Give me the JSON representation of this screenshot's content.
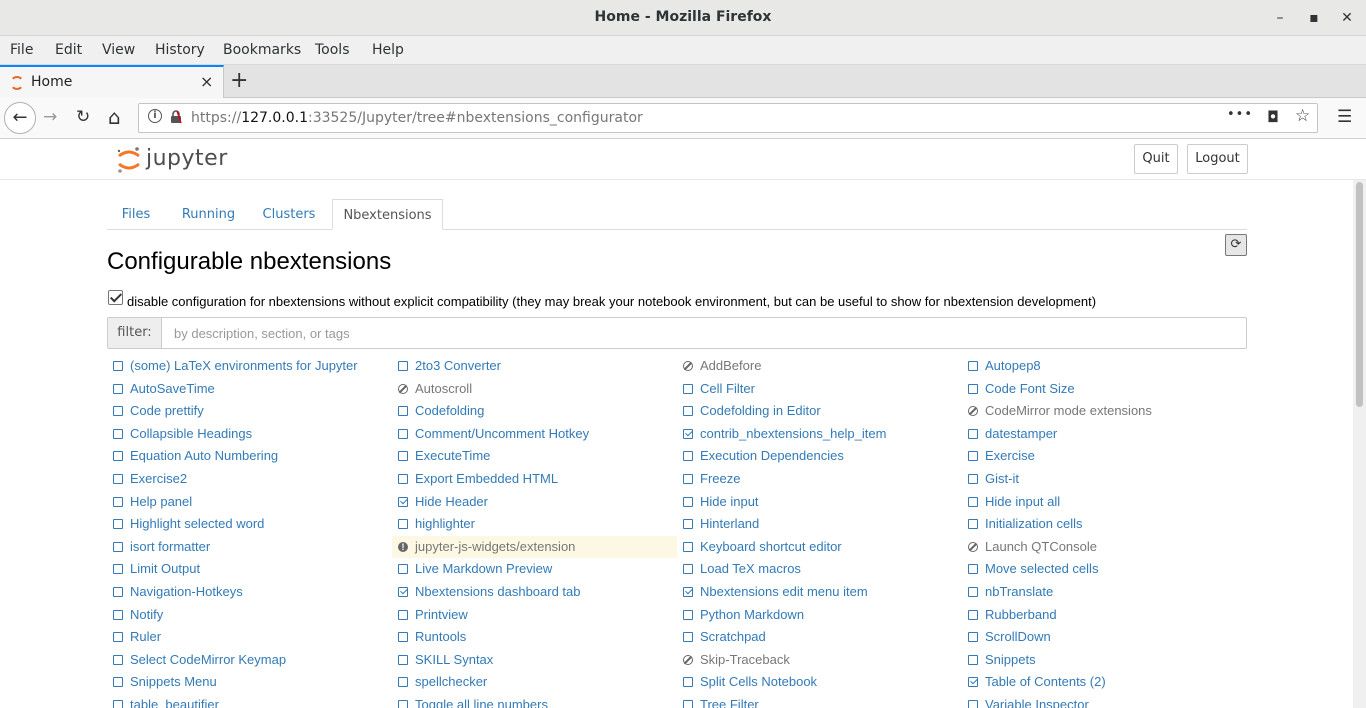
{
  "window": {
    "title": "Home - Mozilla Firefox",
    "minimize": "–",
    "maximize": "▪",
    "close": "✕"
  },
  "menubar": [
    {
      "key": "F",
      "rest": "ile"
    },
    {
      "key": "E",
      "rest": "dit"
    },
    {
      "key": "V",
      "rest": "iew"
    },
    {
      "key": "",
      "pre": "Hi",
      "ukey": "s",
      "rest": "tory"
    },
    {
      "key": "B",
      "rest": "ookmarks"
    },
    {
      "key": "T",
      "rest": "ools"
    },
    {
      "key": "H",
      "rest": "elp"
    }
  ],
  "menu_labels": [
    "File",
    "Edit",
    "View",
    "History",
    "Bookmarks",
    "Tools",
    "Help"
  ],
  "browser_tab": {
    "label": "Home",
    "close": "×",
    "new_tab": "+"
  },
  "nav": {
    "back": "←",
    "forward": "→",
    "reload": "↻",
    "home": "⌂",
    "url_prefix": "https://",
    "url_host": "127.0.0.1",
    "url_rest": ":33525/Jupyter/tree#nbextensions_configurator",
    "page_actions": "•••",
    "pocket": "◘",
    "bookmark": "☆",
    "menu": "☰"
  },
  "jupyter": {
    "logo_text": "jupyter",
    "quit_label": "Quit",
    "logout_label": "Logout",
    "tabs": [
      "Files",
      "Running",
      "Clusters",
      "Nbextensions"
    ],
    "active_tab": "Nbextensions",
    "refresh_icon": "⟳",
    "heading": "Configurable nbextensions",
    "compat_label": "disable configuration for nbextensions without explicit compatibility (they may break your notebook environment, but can be useful to show for nbextension development)",
    "filter_label": "filter:",
    "filter_placeholder": "by description, section, or tags"
  },
  "extensions": [
    [
      {
        "name": "(some) LaTeX environments for Jupyter",
        "state": "off"
      },
      {
        "name": "AutoSaveTime",
        "state": "off"
      },
      {
        "name": "Code prettify",
        "state": "off"
      },
      {
        "name": "Collapsible Headings",
        "state": "off"
      },
      {
        "name": "Equation Auto Numbering",
        "state": "off"
      },
      {
        "name": "Exercise2",
        "state": "off"
      },
      {
        "name": "Help panel",
        "state": "off"
      },
      {
        "name": "Highlight selected word",
        "state": "off"
      },
      {
        "name": "isort formatter",
        "state": "off"
      },
      {
        "name": "Limit Output",
        "state": "off"
      },
      {
        "name": "Navigation-Hotkeys",
        "state": "off"
      },
      {
        "name": "Notify",
        "state": "off"
      },
      {
        "name": "Ruler",
        "state": "off"
      },
      {
        "name": "Select CodeMirror Keymap",
        "state": "off"
      },
      {
        "name": "Snippets Menu",
        "state": "off"
      },
      {
        "name": "table_beautifier",
        "state": "off"
      }
    ],
    [
      {
        "name": "2to3 Converter",
        "state": "off"
      },
      {
        "name": "Autoscroll",
        "state": "incompatible"
      },
      {
        "name": "Codefolding",
        "state": "off"
      },
      {
        "name": "Comment/Uncomment Hotkey",
        "state": "off"
      },
      {
        "name": "ExecuteTime",
        "state": "off"
      },
      {
        "name": "Export Embedded HTML",
        "state": "off"
      },
      {
        "name": "Hide Header",
        "state": "on"
      },
      {
        "name": "highlighter",
        "state": "off"
      },
      {
        "name": "jupyter-js-widgets/extension",
        "state": "warning"
      },
      {
        "name": "Live Markdown Preview",
        "state": "off"
      },
      {
        "name": "Nbextensions dashboard tab",
        "state": "on"
      },
      {
        "name": "Printview",
        "state": "off"
      },
      {
        "name": "Runtools",
        "state": "off"
      },
      {
        "name": "SKILL Syntax",
        "state": "off"
      },
      {
        "name": "spellchecker",
        "state": "off"
      },
      {
        "name": "Toggle all line numbers",
        "state": "off"
      }
    ],
    [
      {
        "name": "AddBefore",
        "state": "incompatible"
      },
      {
        "name": "Cell Filter",
        "state": "off"
      },
      {
        "name": "Codefolding in Editor",
        "state": "off"
      },
      {
        "name": "contrib_nbextensions_help_item",
        "state": "on"
      },
      {
        "name": "Execution Dependencies",
        "state": "off"
      },
      {
        "name": "Freeze",
        "state": "off"
      },
      {
        "name": "Hide input",
        "state": "off"
      },
      {
        "name": "Hinterland",
        "state": "off"
      },
      {
        "name": "Keyboard shortcut editor",
        "state": "off"
      },
      {
        "name": "Load TeX macros",
        "state": "off"
      },
      {
        "name": "Nbextensions edit menu item",
        "state": "on"
      },
      {
        "name": "Python Markdown",
        "state": "off"
      },
      {
        "name": "Scratchpad",
        "state": "off"
      },
      {
        "name": "Skip-Traceback",
        "state": "incompatible"
      },
      {
        "name": "Split Cells Notebook",
        "state": "off"
      },
      {
        "name": "Tree Filter",
        "state": "off"
      }
    ],
    [
      {
        "name": "Autopep8",
        "state": "off"
      },
      {
        "name": "Code Font Size",
        "state": "off"
      },
      {
        "name": "CodeMirror mode extensions",
        "state": "incompatible"
      },
      {
        "name": "datestamper",
        "state": "off"
      },
      {
        "name": "Exercise",
        "state": "off"
      },
      {
        "name": "Gist-it",
        "state": "off"
      },
      {
        "name": "Hide input all",
        "state": "off"
      },
      {
        "name": "Initialization cells",
        "state": "off"
      },
      {
        "name": "Launch QTConsole",
        "state": "incompatible"
      },
      {
        "name": "Move selected cells",
        "state": "off"
      },
      {
        "name": "nbTranslate",
        "state": "off"
      },
      {
        "name": "Rubberband",
        "state": "off"
      },
      {
        "name": "ScrollDown",
        "state": "off"
      },
      {
        "name": "Snippets",
        "state": "off"
      },
      {
        "name": "Table of Contents (2)",
        "state": "on"
      },
      {
        "name": "Variable Inspector",
        "state": "off"
      }
    ]
  ]
}
